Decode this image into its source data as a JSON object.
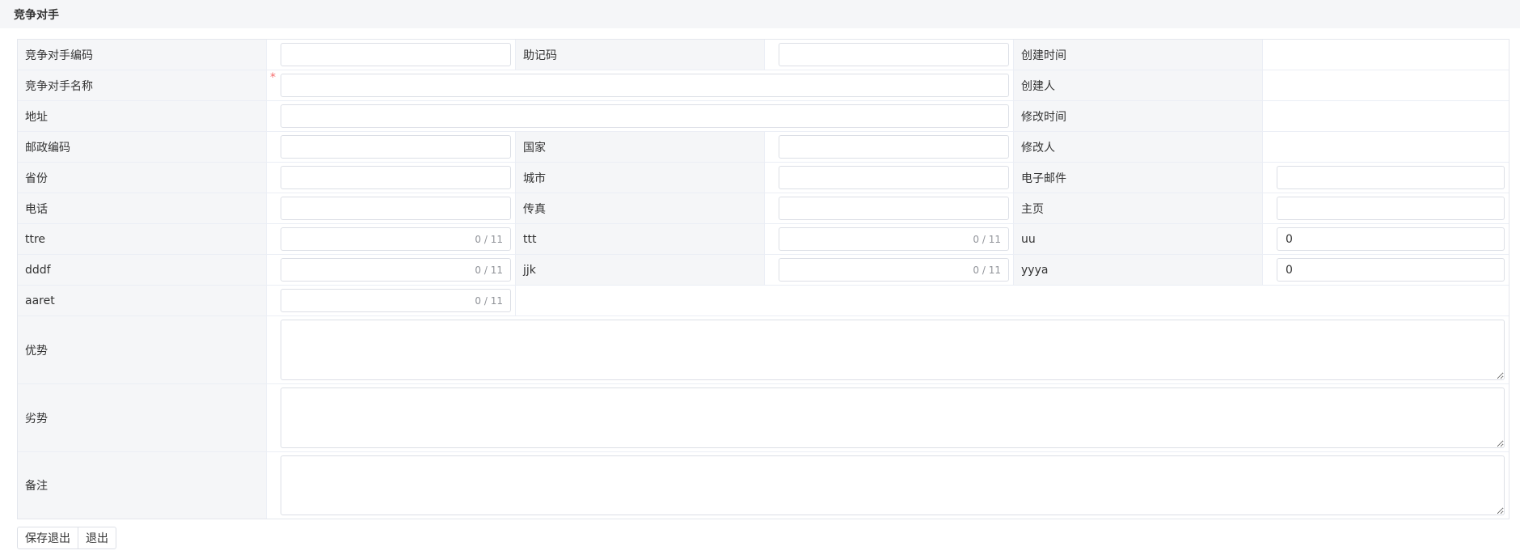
{
  "page": {
    "title": "竞争对手"
  },
  "form": {
    "code_label": "竞争对手编码",
    "mnemonic_label": "助记码",
    "created_time_label": "创建时间",
    "name_label": "竞争对手名称",
    "required_mark": "*",
    "creator_label": "创建人",
    "address_label": "地址",
    "modified_time_label": "修改时间",
    "postal_code_label": "邮政编码",
    "country_label": "国家",
    "modifier_label": "修改人",
    "province_label": "省份",
    "city_label": "城市",
    "email_label": "电子邮件",
    "phone_label": "电话",
    "fax_label": "传真",
    "homepage_label": "主页",
    "ttre_label": "ttre",
    "ttre_counter": "0 / 11",
    "ttt_label": "ttt",
    "ttt_counter": "0 / 11",
    "uu_label": "uu",
    "uu_value": "0",
    "dddf_label": "dddf",
    "dddf_counter": "0 / 11",
    "jjk_label": "jjk",
    "jjk_counter": "0 / 11",
    "yyya_label": "yyya",
    "yyya_value": "0",
    "aaret_label": "aaret",
    "aaret_counter": "0 / 11",
    "advantage_label": "优势",
    "disadvantage_label": "劣势",
    "remark_label": "备注"
  },
  "buttons": {
    "save_exit": "保存退出",
    "exit": "退出"
  }
}
